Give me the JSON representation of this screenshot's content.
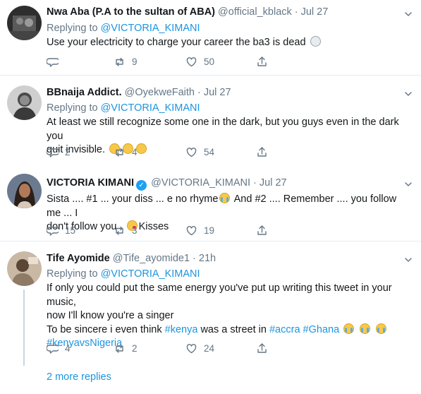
{
  "tweets": [
    {
      "name": "Nwa Aba (P.A to the sultan of ABA)",
      "handle": "@official_kblack",
      "date": "Jul 27",
      "replying_label": "Replying to",
      "replying_to": "@VICTORIA_KIMANI",
      "text": "Use your electricity to charge your career the ba3 is dead",
      "reply_count": "",
      "retweet_count": "9",
      "like_count": "50"
    },
    {
      "name": "BBnaija Addict.",
      "handle": "@OyekweFaith",
      "date": "Jul 27",
      "replying_label": "Replying to",
      "replying_to": "@VICTORIA_KIMANI",
      "text_line1": "At least we still recognize some one in the dark, but you guys even in the dark you",
      "text_line2": "quit invisible.",
      "reply_count": "2",
      "retweet_count": "4",
      "like_count": "54"
    },
    {
      "name": "VICTORIA KIMANI",
      "handle": "@VICTORIA_KIMANI",
      "date": "Jul 27",
      "verified": true,
      "text_line1a": "Sista .... #1 ... your diss ... e no rhyme",
      "text_line1b": "And  #2 .... Remember .... you follow me ... I",
      "text_line2a": "don't follow you .",
      "text_line2b": "Kisses",
      "reply_count": "15",
      "retweet_count": "3",
      "like_count": "19"
    },
    {
      "name": "Tife Ayomide",
      "handle": "@Tife_ayomide1",
      "date": "21h",
      "replying_label": "Replying to",
      "replying_to": "@VICTORIA_KIMANI",
      "text_line1": "If only you could put the same energy you've put up writing this tweet in your music,",
      "text_line2": "now I'll know you're a singer",
      "text_line3": "To be sincere i even think",
      "hashtag_kenya": "#kenya",
      "text_line3b": "was a street in",
      "hashtag_accra": "#accra",
      "hashtag_ghana": "#Ghana",
      "hashtag_kvn": "#kenyavsNigeria",
      "reply_count": "4",
      "retweet_count": "2",
      "like_count": "24"
    }
  ],
  "more_replies": "2 more replies",
  "colors": {
    "link": "#1b95e0",
    "muted": "#657786",
    "verified": "#1da1f2",
    "border": "#e6ecf0"
  }
}
